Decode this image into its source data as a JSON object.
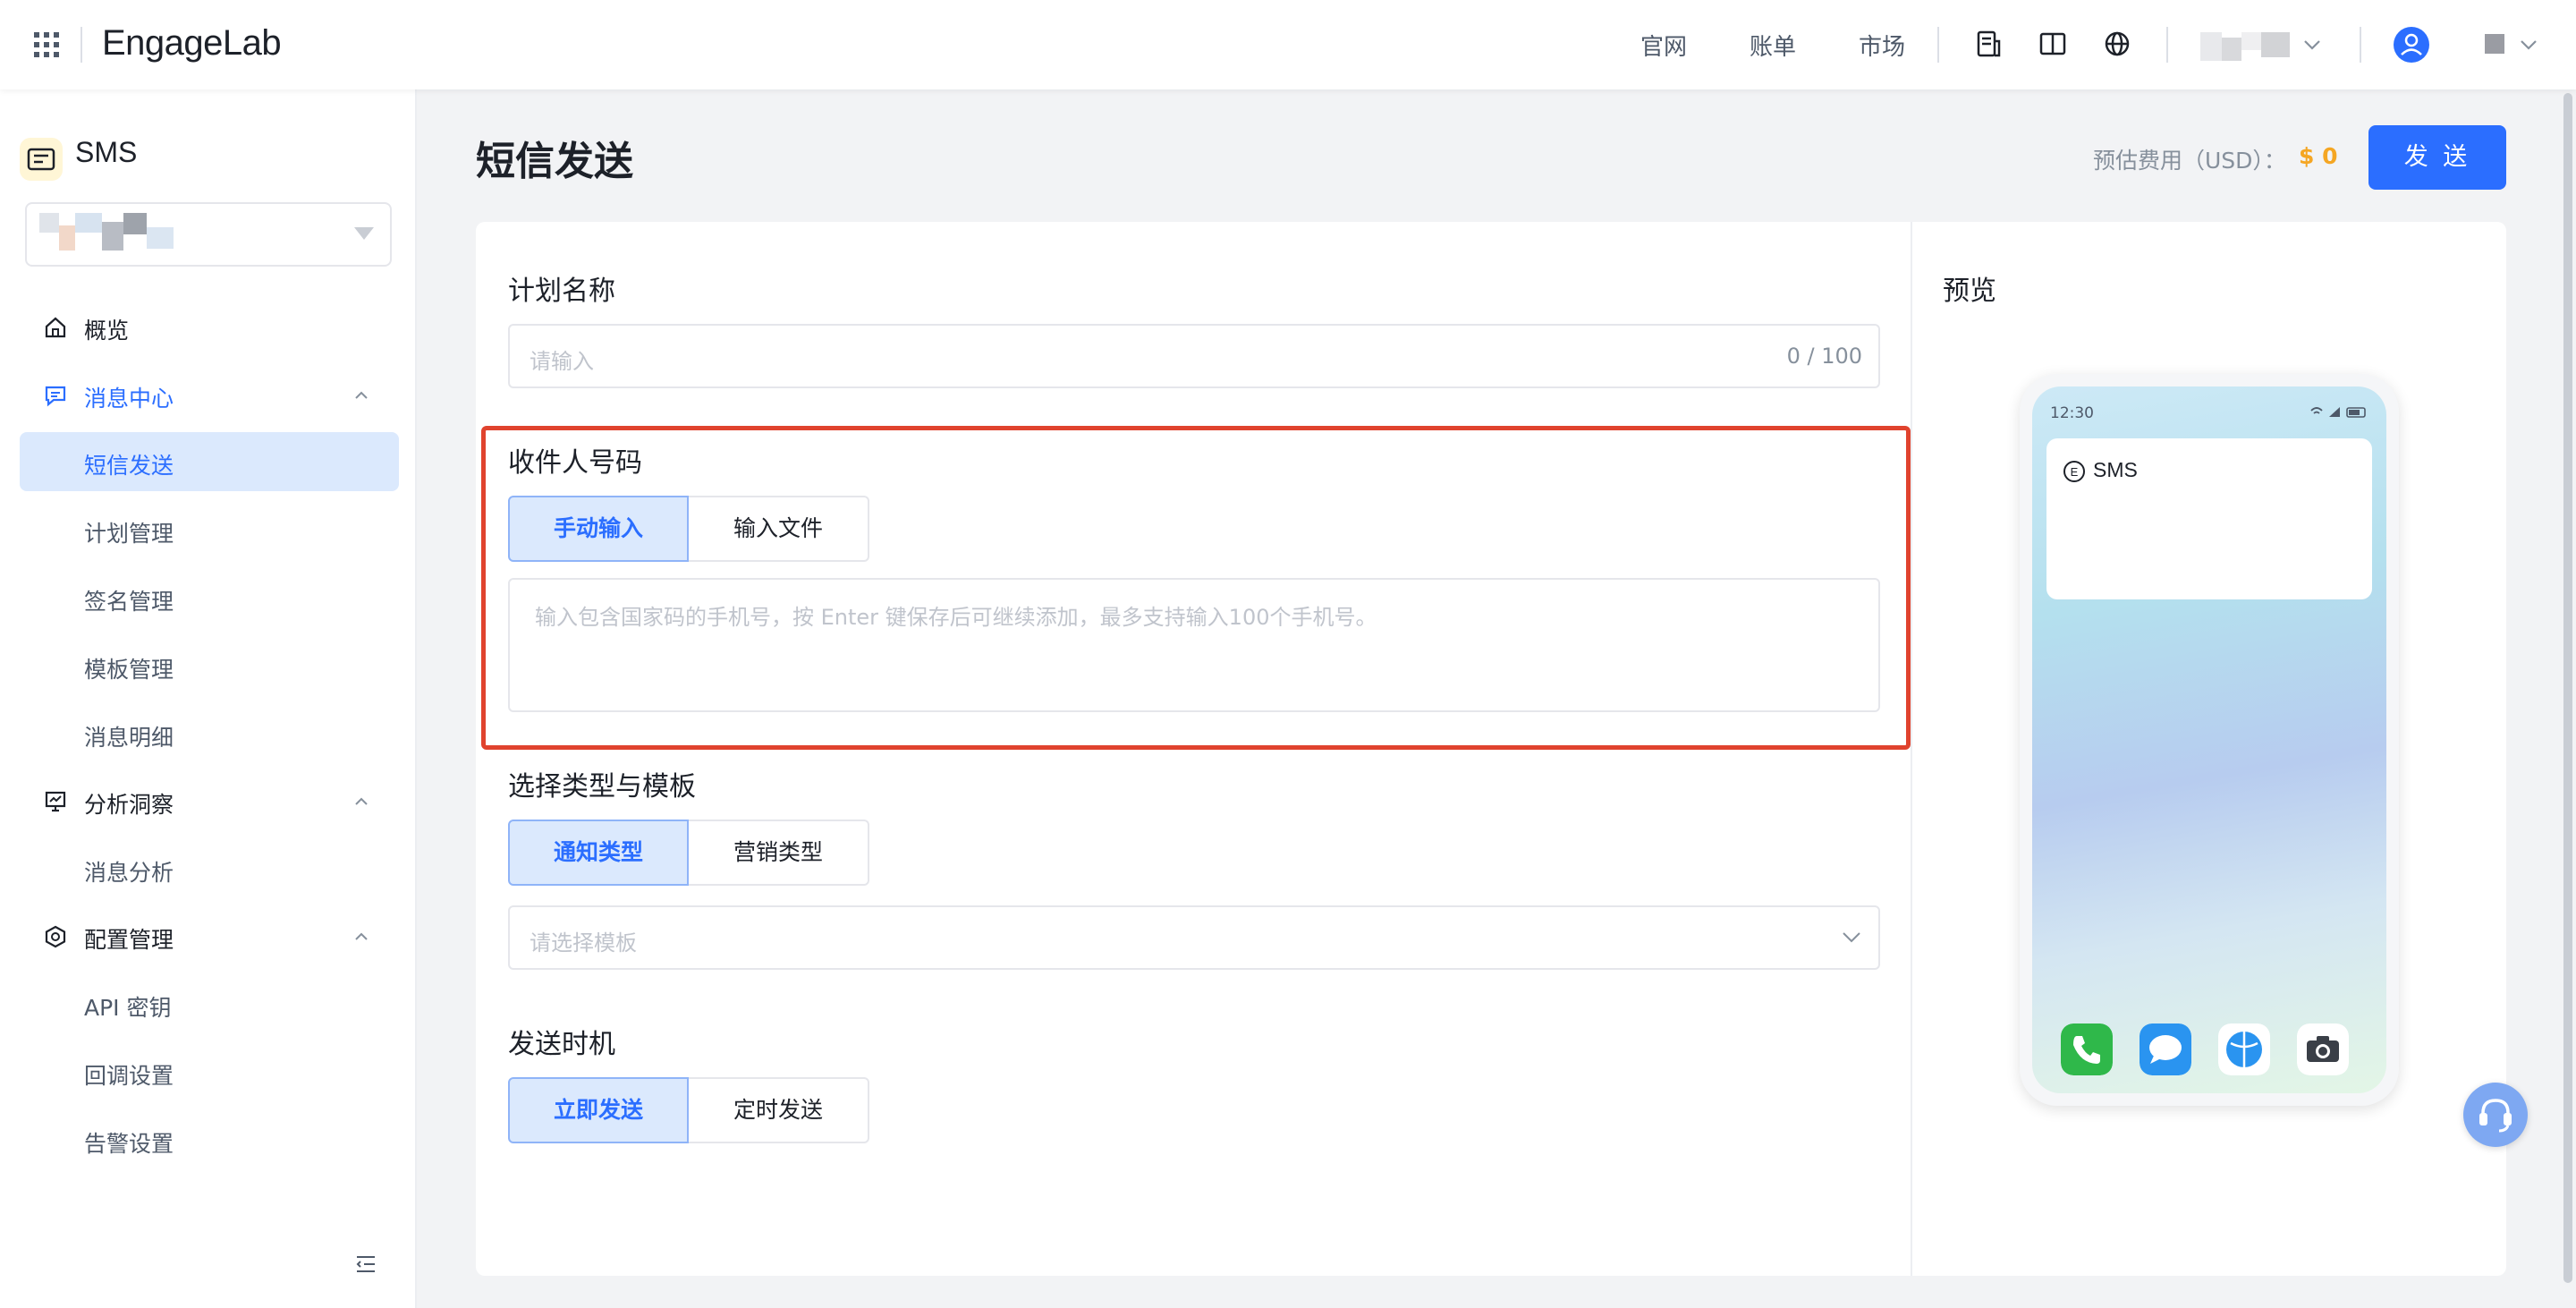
{
  "header": {
    "logo_text": "EngageLab",
    "nav": [
      "官网",
      "账单",
      "市场"
    ]
  },
  "sidebar": {
    "product": "SMS",
    "items": [
      {
        "label": "概览"
      },
      {
        "label": "消息中心"
      },
      {
        "label": "短信发送"
      },
      {
        "label": "计划管理"
      },
      {
        "label": "签名管理"
      },
      {
        "label": "模板管理"
      },
      {
        "label": "消息明细"
      },
      {
        "label": "分析洞察"
      },
      {
        "label": "消息分析"
      },
      {
        "label": "配置管理"
      },
      {
        "label": "API 密钥"
      },
      {
        "label": "回调设置"
      },
      {
        "label": "告警设置"
      }
    ]
  },
  "page": {
    "title": "短信发送",
    "cost_label": "预估费用（USD）：",
    "cost_value": "$ 0",
    "send_label": "发 送"
  },
  "form": {
    "plan_name": {
      "label": "计划名称",
      "placeholder": "请输入",
      "counter": "0 / 100"
    },
    "recipients": {
      "label": "收件人号码",
      "tabs": [
        "手动输入",
        "输入文件"
      ],
      "placeholder": "输入包含国家码的手机号，按 Enter 键保存后可继续添加，最多支持输入100个手机号。"
    },
    "type_template": {
      "label": "选择类型与模板",
      "tabs": [
        "通知类型",
        "营销类型"
      ],
      "placeholder": "请选择模板"
    },
    "send_time": {
      "label": "发送时机",
      "tabs": [
        "立即发送",
        "定时发送"
      ]
    }
  },
  "preview": {
    "title": "预览",
    "time": "12:30",
    "sender": "SMS",
    "dock_icons": [
      "phone-icon",
      "messages-icon",
      "browser-icon",
      "camera-icon"
    ]
  },
  "colors": {
    "accent": "#2b6eff",
    "highlight": "#e0432e",
    "cost": "#f5a623"
  }
}
